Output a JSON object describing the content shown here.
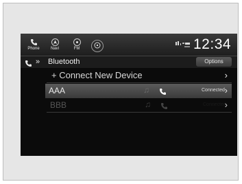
{
  "topbar": {
    "phone_label": "Phone",
    "navi_label": "Navi",
    "fm_label": "FM",
    "clock": "12:34"
  },
  "header": {
    "title": "Bluetooth",
    "options_label": "Options"
  },
  "rows": [
    {
      "label": "+ Connect New Device"
    },
    {
      "label": "AAA",
      "status": "Connected"
    },
    {
      "label": "BBB",
      "status": "Connected"
    }
  ],
  "colors": {
    "screen_bg": "#0b0b0b",
    "selected_row": "#4a4a4a",
    "text": "#e8e8e8",
    "dim_text": "#555555"
  }
}
